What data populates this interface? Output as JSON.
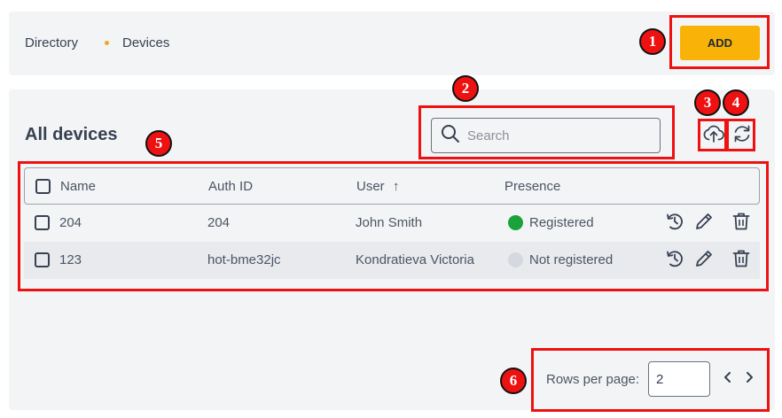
{
  "breadcrumb": {
    "items": [
      "Directory",
      "Devices"
    ]
  },
  "header": {
    "add_label": "ADD"
  },
  "main": {
    "title": "All devices",
    "search": {
      "placeholder": "Search",
      "value": ""
    }
  },
  "table": {
    "columns": [
      "Name",
      "Auth ID",
      "User",
      "Presence"
    ],
    "sort_indicator": "↑",
    "rows": [
      {
        "name": "204",
        "auth_id": "204",
        "user": "John Smith",
        "presence": "Registered",
        "presence_color": "#1aa33a"
      },
      {
        "name": "123",
        "auth_id": "hot-bme32jc",
        "user": "Kondratieva Victoria",
        "presence": "Not registered",
        "presence_color": "#d5d8de"
      }
    ]
  },
  "pagination": {
    "rows_per_page_label": "Rows per page:",
    "rows_per_page_value": "2"
  },
  "annotations": [
    "1",
    "2",
    "3",
    "4",
    "5",
    "6"
  ],
  "colors": {
    "accent": "#f9b208",
    "highlight": "#ee1111",
    "panel": "#f3f4f6"
  }
}
